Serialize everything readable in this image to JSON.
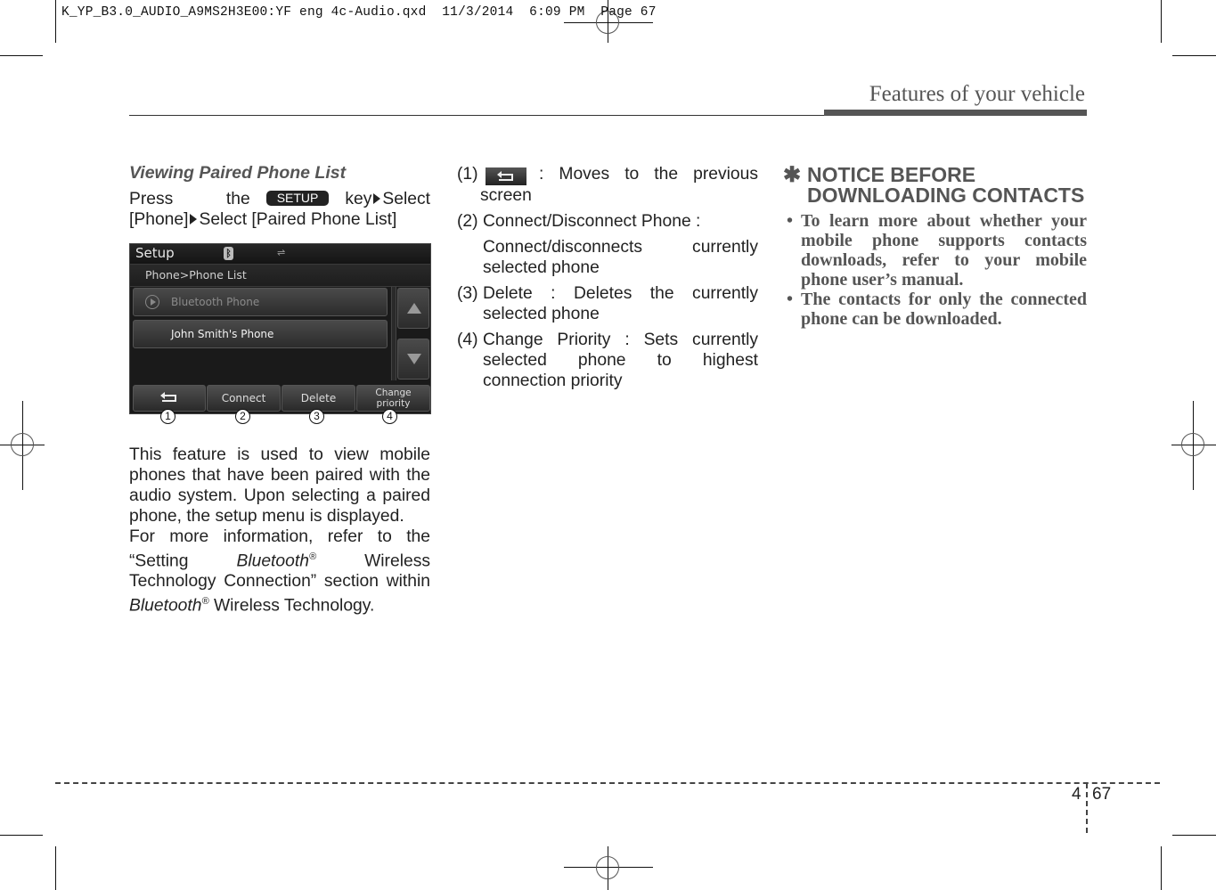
{
  "slug": "K_YP_B3.0_AUDIO_A9MS2H3E00:YF eng 4c-Audio.qxd  11/3/2014  6:09 PM  Page 67",
  "header": {
    "title": "Features of your vehicle"
  },
  "left_column": {
    "section_title": "Viewing Paired Phone List",
    "instr_press": "Press the",
    "setup_key": "SETUP",
    "instr_key": "key",
    "instr_select1": "Select",
    "instr_phone": "[Phone]",
    "instr_select2": "Select [Paired Phone List]",
    "screen": {
      "title": "Setup",
      "bt_icon": "bluetooth-icon",
      "usb_icon": "usb-icon",
      "breadcrumb": "Phone>Phone List",
      "items": [
        {
          "label": "Bluetooth Phone",
          "icon": "play-icon"
        },
        {
          "label": "John Smith's Phone"
        }
      ],
      "buttons": [
        {
          "label": "",
          "icon": "back-arrow-icon"
        },
        {
          "label": "Connect"
        },
        {
          "label": "Delete"
        },
        {
          "label_line1": "Change",
          "label_line2": "priority"
        }
      ],
      "callouts": [
        "1",
        "2",
        "3",
        "4"
      ]
    },
    "para1": "This feature is used to view mobile phones that have been paired with the audio system. Upon selecting a paired phone, the setup menu is displayed.",
    "para2_a": "For more information, refer to the “Setting",
    "para2_bt": "Bluetooth",
    "para2_reg": "®",
    "para2_b": "Wireless Technology Connection” section within",
    "para2_bt2": "Bluetooth",
    "para2_c": "Wireless Technology."
  },
  "middle_column": {
    "items": [
      {
        "num": "(1)",
        "text": ": Moves to the previous screen"
      },
      {
        "num": "(2)",
        "text": "Connect/Disconnect Phone :",
        "sub": "Connect/disconnects currently selected phone"
      },
      {
        "num": "(3)",
        "text": "Delete : Deletes the currently selected phone"
      },
      {
        "num": "(4)",
        "text": "Change Priority : Sets currently selected phone to highest connection priority"
      }
    ]
  },
  "right_column": {
    "notice_symbol": "✱",
    "notice_title": "NOTICE BEFORE DOWNLOADING CONTACTS",
    "bullets": [
      "To learn more about whether your mobile phone supports contacts downloads, refer to your mobile phone user’s manual.",
      "The contacts for only the connected phone can be downloaded."
    ]
  },
  "footer": {
    "chapter": "4",
    "page": "67"
  }
}
